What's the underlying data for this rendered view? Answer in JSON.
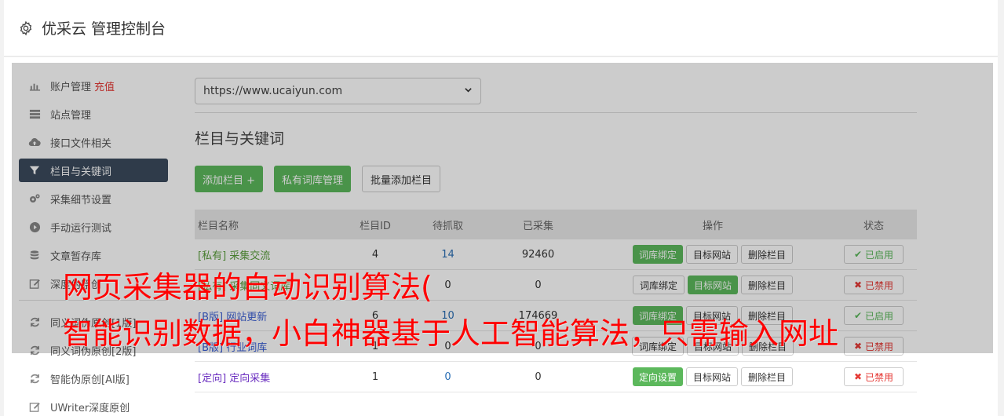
{
  "header": {
    "title": "优采云 管理控制台"
  },
  "sidebar": {
    "items": [
      {
        "label": "账户管理",
        "extra": "充值",
        "icon": "bar-chart-icon"
      },
      {
        "label": "站点管理",
        "icon": "server-icon"
      },
      {
        "label": "接口文件相关",
        "icon": "cloud-upload-icon"
      },
      {
        "label": "栏目与关键词",
        "icon": "filter-icon"
      },
      {
        "label": "采集细节设置",
        "icon": "gears-icon"
      },
      {
        "label": "手动运行测试",
        "icon": "play-circle-icon"
      },
      {
        "label": "文章暂存库",
        "icon": "database-icon"
      },
      {
        "label": "深度伪原创",
        "icon": "edit-icon"
      }
    ],
    "items2": [
      {
        "label": "同义词伪原创[1版]",
        "icon": "refresh-icon"
      },
      {
        "label": "同义词伪原创[2版]",
        "icon": "refresh-icon"
      },
      {
        "label": "智能伪原创[AI版]",
        "icon": "refresh-icon"
      },
      {
        "label": "UWriter深度原创",
        "icon": "edit-icon"
      }
    ]
  },
  "main": {
    "site_select": "https://www.ucaiyun.com",
    "section_title": "栏目与关键词",
    "buttons": {
      "add_column": "添加栏目 +",
      "private_lib": "私有词库管理",
      "batch_add": "批量添加栏目"
    },
    "table": {
      "headers": {
        "name": "栏目名称",
        "id": "栏目ID",
        "pending": "待抓取",
        "collected": "已采集",
        "ops": "操作",
        "status": "状态"
      },
      "rows": [
        {
          "tag": "[私有]",
          "name": "采集交流",
          "id": "4",
          "pending": "14",
          "collected": "92460",
          "op1": "词库绑定",
          "op2": "目标网站",
          "op3": "删除栏目",
          "status": "已启用"
        },
        {
          "tag": "[私有]",
          "name": "采集同义词库",
          "id": "",
          "pending": "0",
          "collected": "0",
          "op1": "词库绑定",
          "op2": "目标网站",
          "op3": "删除栏目",
          "status": "已禁用"
        },
        {
          "tag": "[B版]",
          "name": "网站更新",
          "id": "6",
          "pending": "10",
          "collected": "174669",
          "op1": "词库绑定",
          "op2": "目标网站",
          "op3": "删除栏目",
          "status": "已启用"
        },
        {
          "tag": "[B版]",
          "name": "行业词库",
          "id": "1",
          "pending": "0",
          "collected": "0",
          "op1": "词库绑定",
          "op2": "目标网站",
          "op3": "删除栏目",
          "status": "已禁用"
        },
        {
          "tag": "[定向]",
          "name": "定向采集",
          "id": "1",
          "pending": "0",
          "collected": "0",
          "op1": "定向设置",
          "op2": "目标网站",
          "op3": "删除栏目",
          "status": "已禁用"
        }
      ]
    }
  },
  "caption": {
    "line1": "网页采集器的自动识别算法(",
    "line2": "智能识别数据，小白神器基于人工智能算法，只需输入网址"
  },
  "colors": {
    "accent_green": "#5cb85c",
    "sidebar_active": "#3b4a5d",
    "danger": "#e53935",
    "caption_red": "#ff0000"
  }
}
